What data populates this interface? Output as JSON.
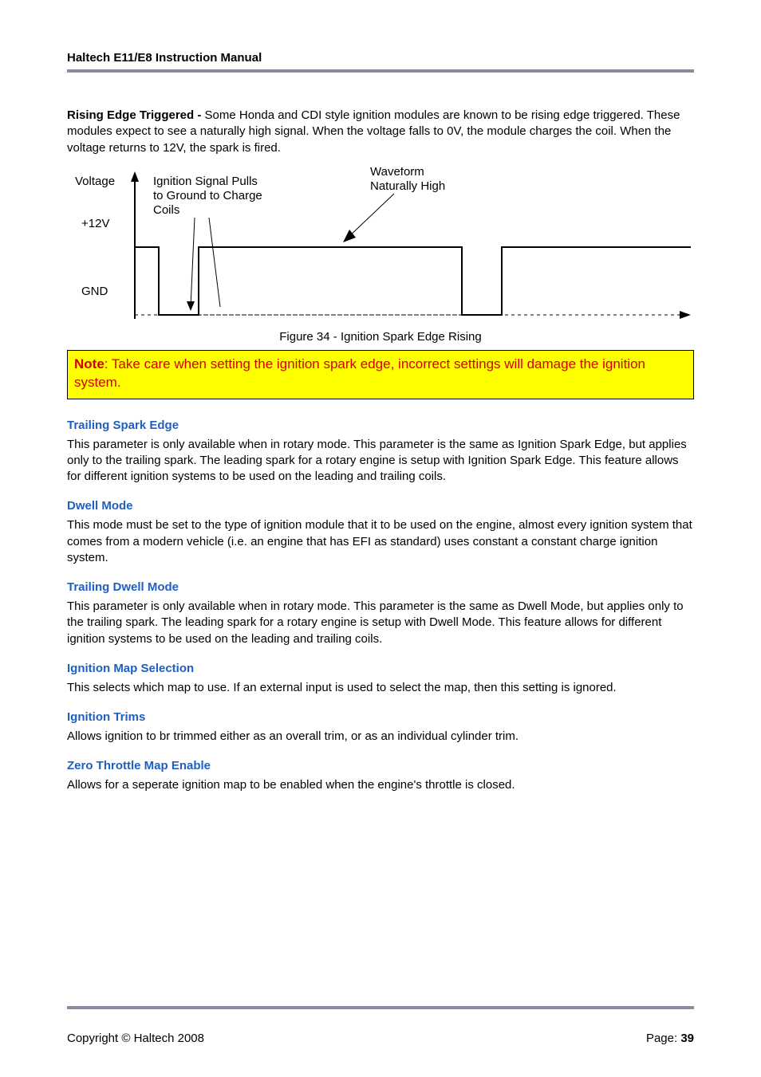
{
  "header": {
    "title": "Haltech E11/E8 Instruction Manual"
  },
  "intro": {
    "bold_lead": "Rising Edge Triggered - ",
    "text": "Some Honda and CDI style ignition modules are known to be rising edge triggered. These modules expect to see a naturally high signal. When the voltage falls to 0V, the module charges the coil. When the voltage returns to 12V, the spark is fired."
  },
  "chart_data": {
    "type": "line",
    "title": "Ignition Spark Edge Rising",
    "x": "time",
    "y_levels": [
      "+12V",
      "GND"
    ],
    "waveform_segments": [
      {
        "level": "+12V",
        "from": 0,
        "to": 1
      },
      {
        "level": "GND",
        "from": 1,
        "to": 2
      },
      {
        "level": "+12V",
        "from": 2,
        "to": 6
      },
      {
        "level": "GND",
        "from": 6,
        "to": 7
      },
      {
        "level": "+12V",
        "from": 7,
        "to": 10
      }
    ],
    "y_axis_label": "Voltage",
    "annotations": {
      "low_pulse": "Ignition Signal Pulls to Ground to Charge Coils",
      "high_line": "Waveform Naturally High"
    },
    "caption": "Figure 34 - Ignition Spark Edge Rising",
    "labels": {
      "voltage": "Voltage",
      "high": "+12V",
      "low": "GND",
      "annot_pull_l1": "Ignition Signal Pulls",
      "annot_pull_l2": "to Ground to Charge",
      "annot_pull_l3": "Coils",
      "annot_nat_l1": "Waveform",
      "annot_nat_l2": "Naturally High"
    }
  },
  "note": {
    "label": "Note",
    "colon": ":",
    "text": " Take care when setting the ignition spark edge, incorrect settings will damage the ignition system."
  },
  "sections": [
    {
      "heading": "Trailing Spark Edge",
      "body": "This parameter is only available when in rotary mode. This parameter is the same as Ignition Spark Edge, but applies only to the trailing spark. The leading spark for a rotary engine is setup with Ignition Spark Edge. This feature allows for different ignition systems to be used on the leading and trailing coils."
    },
    {
      "heading": "Dwell Mode",
      "body": "This mode must be set to the type of ignition module that it to be used on the engine, almost every ignition system that comes from a modern vehicle (i.e. an engine that has EFI as standard) uses constant a constant charge ignition system."
    },
    {
      "heading": "Trailing Dwell Mode",
      "body": "This parameter is only available when in rotary mode. This parameter is the same as Dwell Mode, but applies only to the trailing spark. The leading spark for a rotary engine is setup with Dwell Mode. This feature allows for different ignition systems to be used on the leading and trailing coils."
    },
    {
      "heading": "Ignition Map Selection",
      "body": "This selects which map to use. If an external input is used to select the map, then this setting is ignored."
    },
    {
      "heading": "Ignition Trims",
      "body": "Allows ignition to br trimmed either as an overall trim, or as an individual cylinder trim."
    },
    {
      "heading": "Zero Throttle Map Enable",
      "body": "Allows for a seperate ignition map to be enabled when the engine's throttle is closed."
    }
  ],
  "footer": {
    "copyright": "Copyright © Haltech 2008",
    "page_label": "Page: ",
    "page_number": "39"
  }
}
